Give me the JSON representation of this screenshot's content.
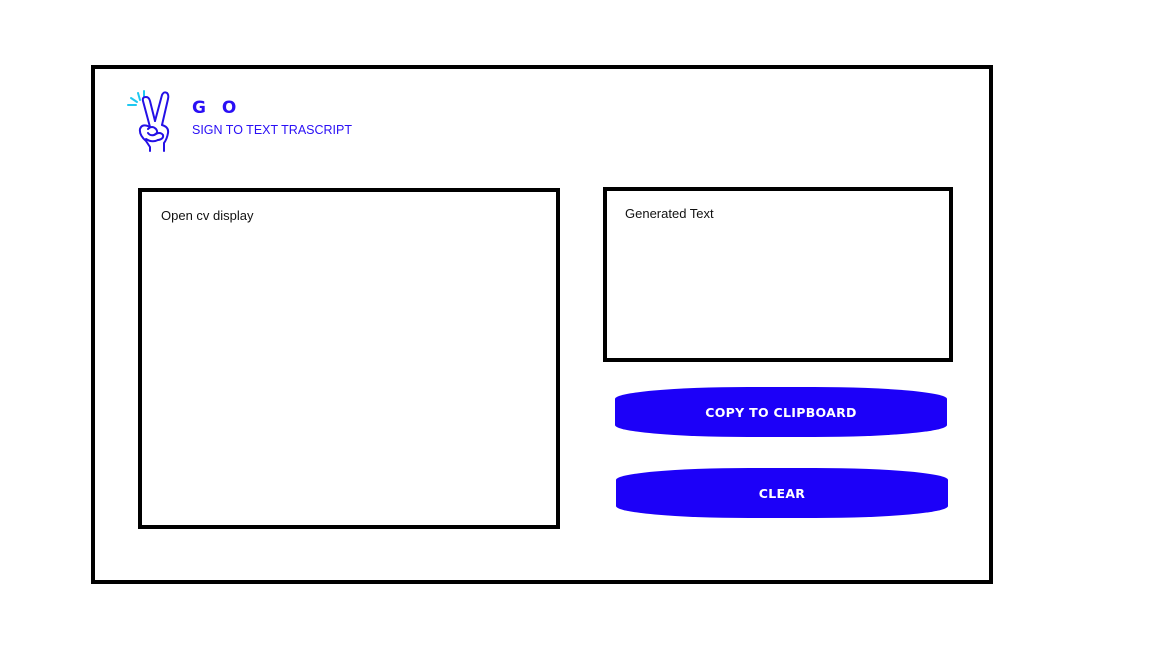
{
  "app": {
    "title": "G O",
    "subtitle": "SIGN TO TEXT TRASCRIPT",
    "logo_icon": "peace-hand-sign-icon"
  },
  "panels": {
    "cv_display_label": "Open cv display",
    "generated_text_label": "Generated Text"
  },
  "buttons": {
    "copy_label": "COPY TO CLIPBOARD",
    "clear_label": "CLEAR"
  },
  "colors": {
    "accent": "#1c00f8",
    "text_accent": "#2a0ff5",
    "logo_spark": "#1ec8f0",
    "border": "#000000"
  }
}
